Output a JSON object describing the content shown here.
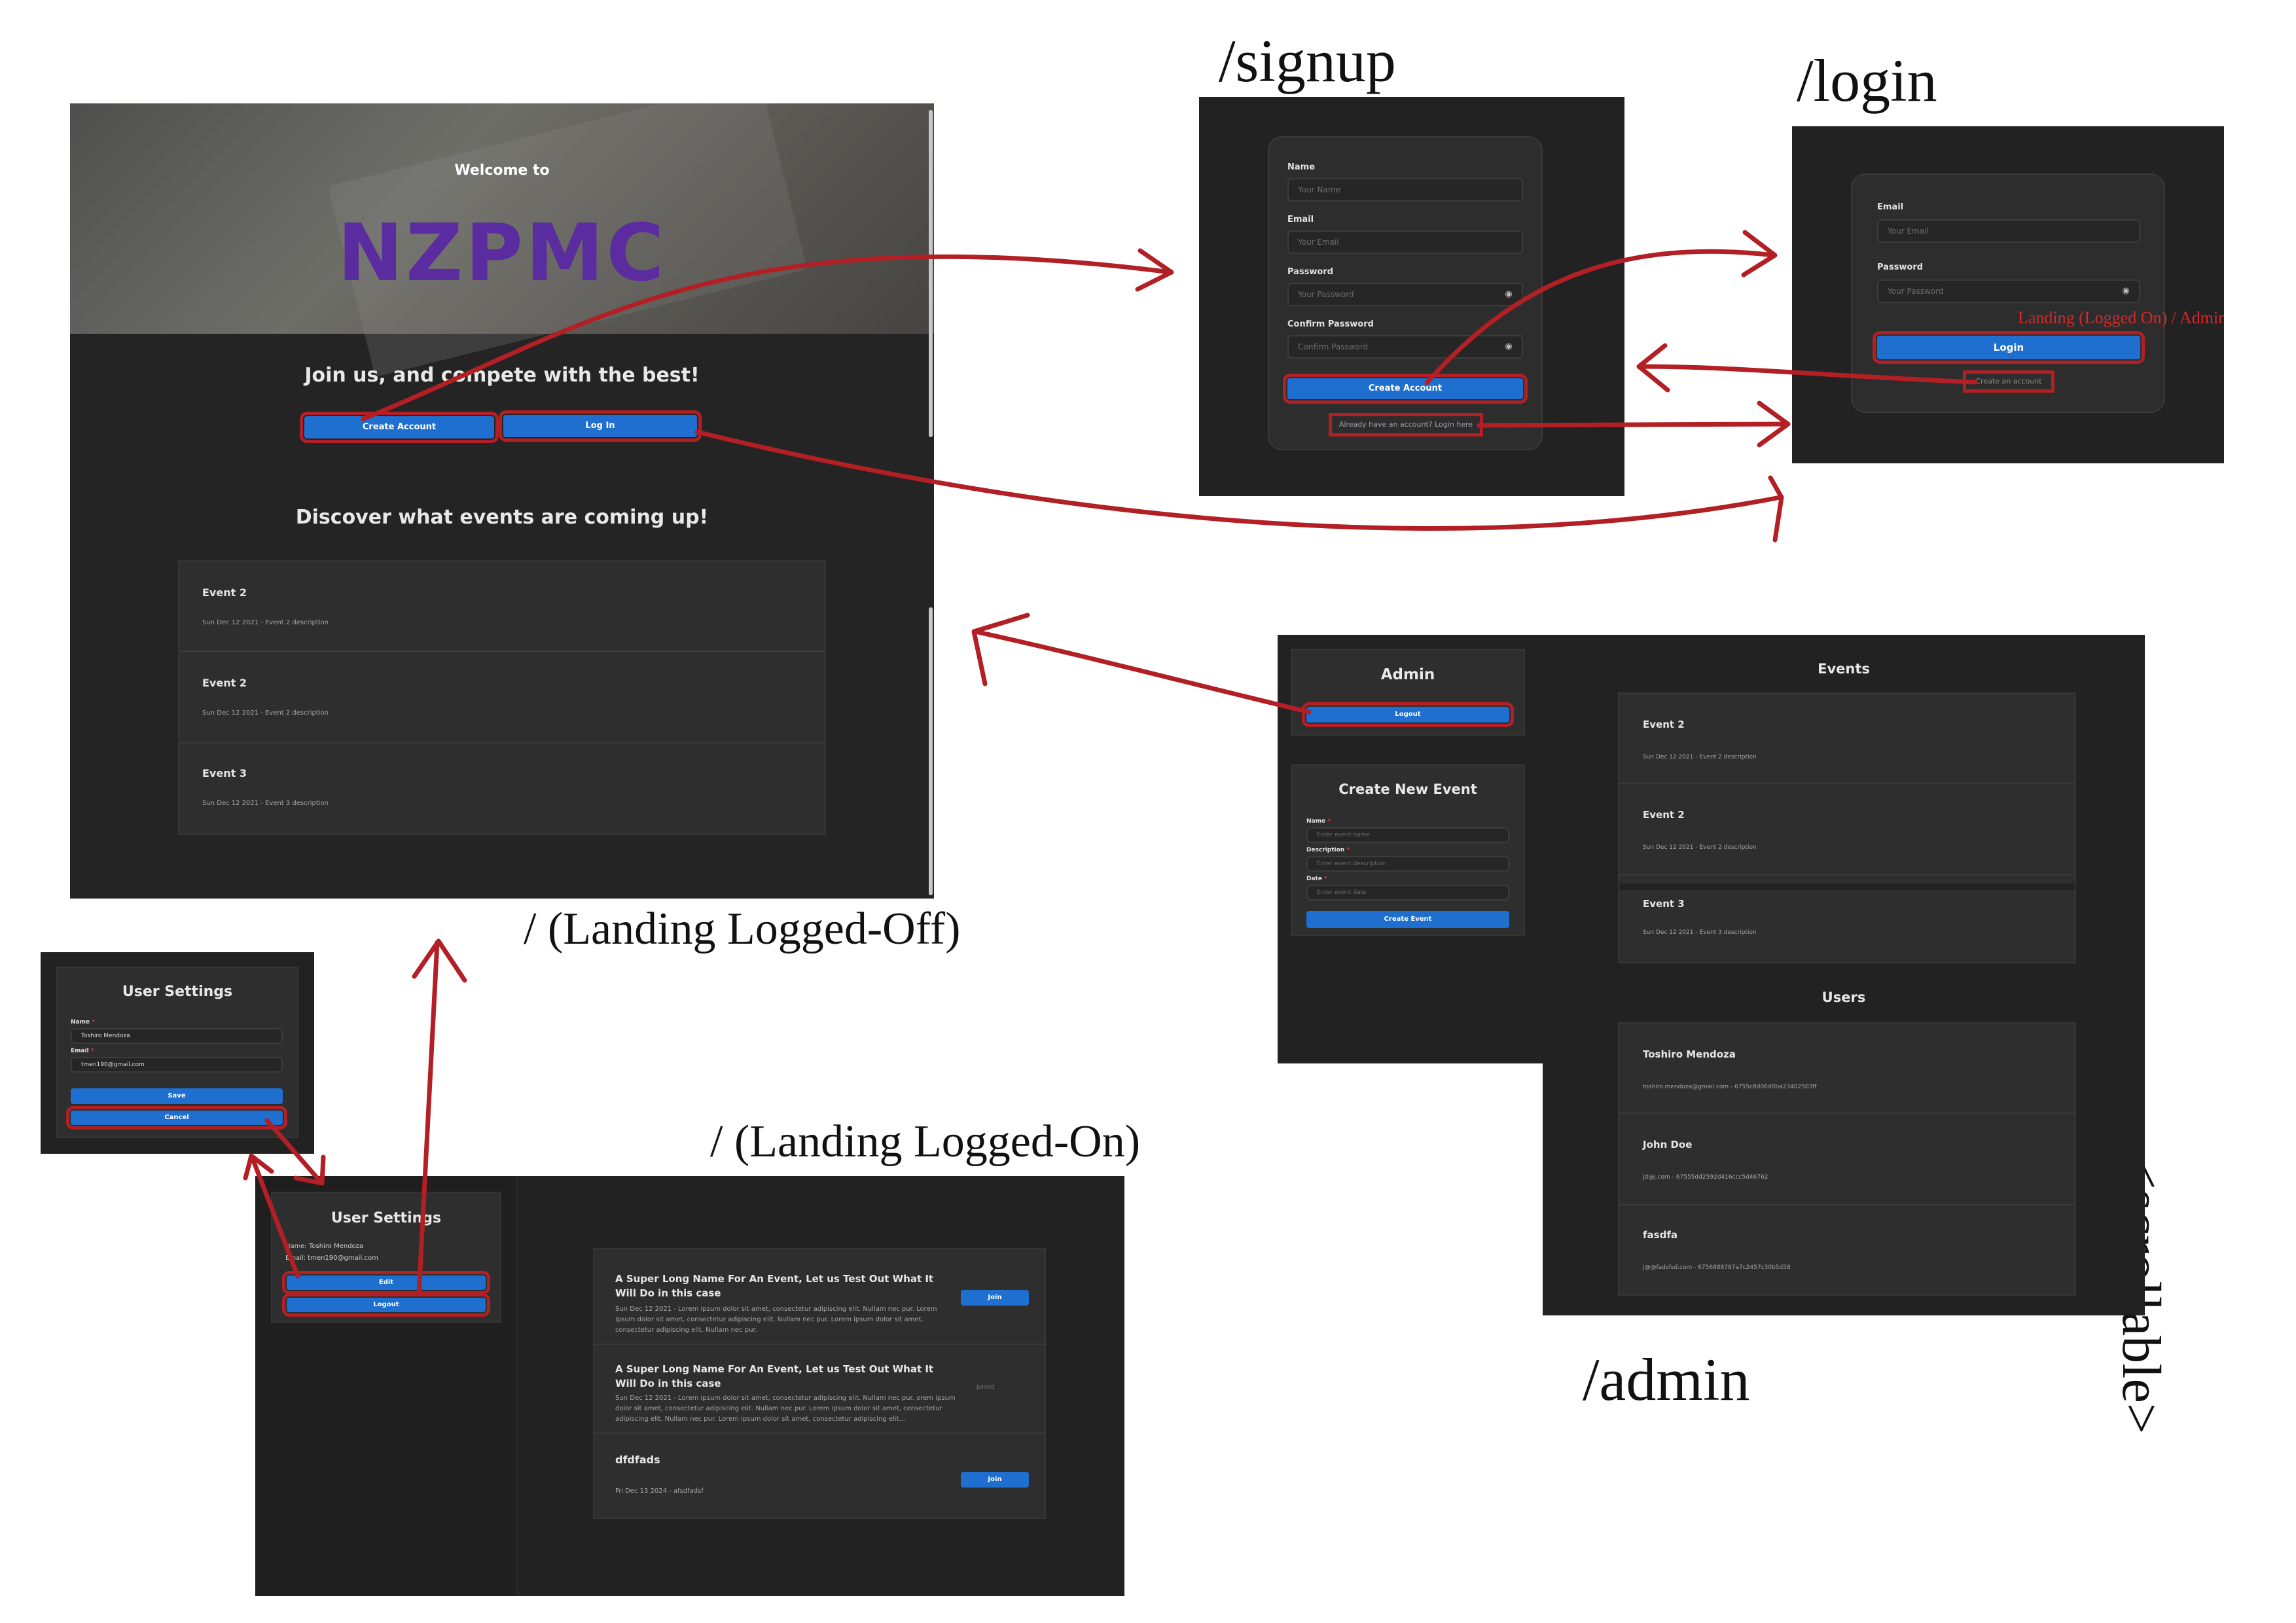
{
  "labels": {
    "signup": "/signup",
    "login": "/login",
    "landing_off": "/ (Landing Logged-Off)",
    "landing_on": "/ (Landing Logged-On)",
    "admin": "/admin",
    "scrollable": "<scrollable>",
    "login_annotation": "Landing (Logged On) / Admin"
  },
  "landing_off": {
    "welcome": "Welcome to",
    "logo": "NZPMC",
    "tagline": "Join us, and compete with the best!",
    "create_account": "Create Account",
    "login": "Log In",
    "discover": "Discover what events are coming up!",
    "events": [
      {
        "title": "Event 2",
        "desc": "Sun Dec 12 2021 - Event 2 description"
      },
      {
        "title": "Event 2",
        "desc": "Sun Dec 12 2021 - Event 2 description"
      },
      {
        "title": "Event 3",
        "desc": "Sun Dec 12 2021 - Event 3 description"
      }
    ]
  },
  "signup": {
    "name_label": "Name",
    "name_ph": "Your Name",
    "email_label": "Email",
    "email_ph": "Your Email",
    "password_label": "Password",
    "password_ph": "Your Password",
    "confirm_label": "Confirm Password",
    "confirm_ph": "Confirm Password",
    "submit": "Create Account",
    "login_link": "Already have an account? Login here"
  },
  "login": {
    "email_label": "Email",
    "email_ph": "Your Email",
    "password_label": "Password",
    "password_ph": "Your Password",
    "submit": "Login",
    "create_link": "Create an account"
  },
  "admin": {
    "title": "Admin",
    "logout": "Logout",
    "create_title": "Create New Event",
    "name_label": "Name",
    "name_ph": "Enter event name",
    "desc_label": "Description",
    "desc_ph": "Enter event description",
    "date_label": "Date",
    "date_ph": "Enter event date",
    "create_btn": "Create Event",
    "events_title": "Events",
    "events": [
      {
        "title": "Event 2",
        "desc": "Sun Dec 12 2021 - Event 2 description"
      },
      {
        "title": "Event 2",
        "desc": "Sun Dec 12 2021 - Event 2 description"
      },
      {
        "title": "Event 3",
        "desc": "Sun Dec 12 2021 - Event 3 description"
      }
    ],
    "users_title": "Users",
    "users": [
      {
        "name": "Toshiro Mendoza",
        "info": "toshiro.mendoza@gmail.com - 6755c8d06d0ba23402503ff"
      },
      {
        "name": "John Doe",
        "info": "jd@j.com - 67555dd2592d416ccc5d46762"
      },
      {
        "name": "fasdfa",
        "info": "j@@fadsfsd.com - 6756888787a7c2457c30b5d58"
      }
    ]
  },
  "user_settings_edit": {
    "title": "User Settings",
    "name_label": "Name",
    "name_value": "Toshiro Mendoza",
    "email_label": "Email",
    "email_value": "tmen190@gmail.com",
    "save": "Save",
    "cancel": "Cancel",
    "required_mark": "*"
  },
  "landing_on": {
    "settings_title": "User Settings",
    "name_line": "Name: Toshiro Mendoza",
    "email_line": "Email: tmen190@gmail.com",
    "edit": "Edit",
    "logout": "Logout",
    "events": [
      {
        "title": "A Super Long Name For An Event, Let us Test Out What It Will Do in this case",
        "desc": "Sun Dec 12 2021 - Lorem ipsum dolor sit amet, consectetur adipiscing elit. Nullam nec pur. Lorem ipsum dolor sit amet, consectetur adipiscing elit. Nullam nec pur. Lorem ipsum dolor sit amet, consectetur adipiscing elit. Nullam nec pur.",
        "action": "Join"
      },
      {
        "title": "A Super Long Name For An Event, Let us Test Out What It Will Do in this case",
        "desc": "Sun Dec 12 2021 - Lorem ipsum dolor sit amet, consectetur adipiscing elit. Nullam nec pur. orem ipsum dolor sit amet, consectetur adipiscing elit. Nullam nec pur. Lorem ipsum dolor sit amet, consectetur adipiscing elit. Nullam nec pur. Lorem ipsum dolor sit amet, consectetur adipiscing elit...",
        "action": "Joined"
      },
      {
        "title": "dfdfads",
        "desc": "Fri Dec 13 2024 - afsdfadsf",
        "action": "Join"
      }
    ]
  },
  "colors": {
    "arrow": "#b21f24",
    "button": "#1e6fd0",
    "background": "#242424",
    "logo": "#5a2ca0"
  }
}
